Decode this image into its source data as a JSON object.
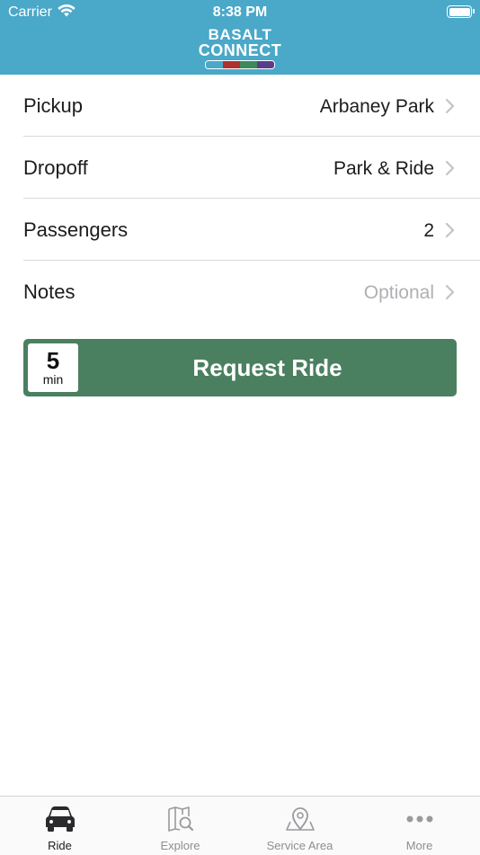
{
  "status_bar": {
    "carrier": "Carrier",
    "time": "8:38 PM"
  },
  "header": {
    "logo_line1": "BASALT",
    "logo_line2": "CONNECT",
    "logo_bar_colors": [
      "#4aa8c8",
      "#b03030",
      "#3c8a5a",
      "#5a3d8a"
    ],
    "background": "#4aa8c8"
  },
  "rows": [
    {
      "label": "Pickup",
      "value": "Arbaney Park",
      "placeholder": false
    },
    {
      "label": "Dropoff",
      "value": "Park & Ride",
      "placeholder": false
    },
    {
      "label": "Passengers",
      "value": "2",
      "placeholder": false
    },
    {
      "label": "Notes",
      "value": "Optional",
      "placeholder": true
    }
  ],
  "request": {
    "eta_value": "5",
    "eta_unit": "min",
    "label": "Request Ride",
    "color": "#4a8060"
  },
  "tabbar": {
    "tabs": [
      {
        "label": "Ride",
        "icon": "car-icon",
        "active": true
      },
      {
        "label": "Explore",
        "icon": "map-search-icon",
        "active": false
      },
      {
        "label": "Service Area",
        "icon": "map-pin-icon",
        "active": false
      },
      {
        "label": "More",
        "icon": "ellipsis-icon",
        "active": false
      }
    ]
  }
}
